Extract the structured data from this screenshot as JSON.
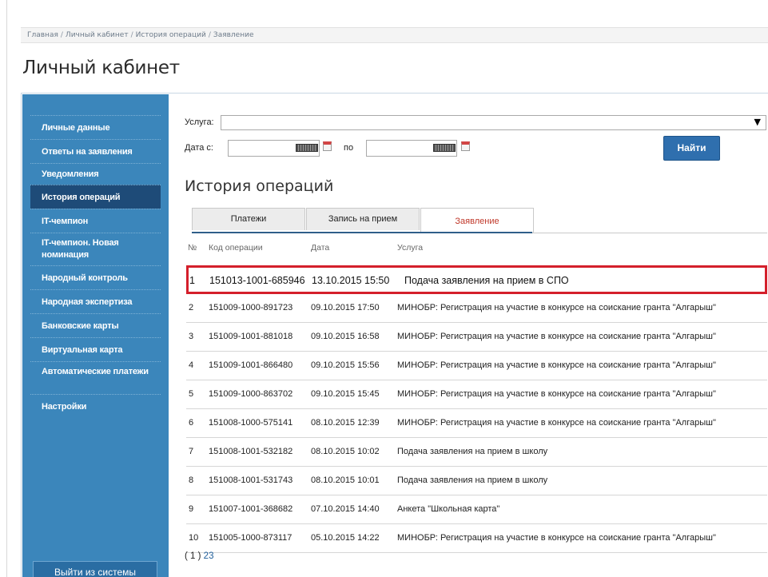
{
  "breadcrumb": [
    "Главная",
    "Личный кабинет",
    "История операций",
    "Заявление"
  ],
  "breadcrumb_sep": "/",
  "page_title": "Личный кабинет",
  "sidebar": {
    "items": [
      {
        "label": "Личные данные",
        "active": false
      },
      {
        "label": "Ответы на заявления",
        "active": false
      },
      {
        "label": "Уведомления",
        "active": false
      },
      {
        "label": "История операций",
        "active": true
      },
      {
        "label": "IT-чемпион",
        "active": false
      },
      {
        "label": "IT-чемпион. Новая номинация",
        "active": false
      },
      {
        "label": "Народный контроль",
        "active": false
      },
      {
        "label": "Народная экспертиза",
        "active": false
      },
      {
        "label": "Банковские карты",
        "active": false
      },
      {
        "label": "Виртуальная карта",
        "active": false
      },
      {
        "label": "Автоматические платежи",
        "active": false
      },
      {
        "label": "Настройки",
        "active": false
      }
    ],
    "logout_label": "Выйти из системы"
  },
  "filters": {
    "service_label": "Услуга:",
    "service_value": "",
    "date_from_label": "Дата с:",
    "date_to_label": "по",
    "date_from_value": "",
    "date_to_value": "",
    "find_label": "Найти"
  },
  "history": {
    "title": "История операций",
    "tabs": [
      "Платежи",
      "Запись на прием",
      "Заявление"
    ],
    "active_tab": 2,
    "columns": [
      "№",
      "Код операции",
      "Дата",
      "Услуга"
    ],
    "rows": [
      {
        "num": "1",
        "code": "151013-1001-685946",
        "date": "13.10.2015 15:50",
        "service": "Подача заявления на прием в СПО"
      },
      {
        "num": "2",
        "code": "151009-1000-891723",
        "date": "09.10.2015 17:50",
        "service": "МИНОБР: Регистрация на участие в конкурсе на соискание гранта \"Алгарыш\""
      },
      {
        "num": "3",
        "code": "151009-1001-881018",
        "date": "09.10.2015 16:58",
        "service": "МИНОБР: Регистрация на участие в конкурсе на соискание гранта \"Алгарыш\""
      },
      {
        "num": "4",
        "code": "151009-1001-866480",
        "date": "09.10.2015 15:56",
        "service": "МИНОБР: Регистрация на участие в конкурсе на соискание гранта \"Алгарыш\""
      },
      {
        "num": "5",
        "code": "151009-1000-863702",
        "date": "09.10.2015 15:45",
        "service": "МИНОБР: Регистрация на участие в конкурсе на соискание гранта \"Алгарыш\""
      },
      {
        "num": "6",
        "code": "151008-1000-575141",
        "date": "08.10.2015 12:39",
        "service": "МИНОБР: Регистрация на участие в конкурсе на соискание гранта \"Алгарыш\""
      },
      {
        "num": "7",
        "code": "151008-1001-532182",
        "date": "08.10.2015 10:02",
        "service": "Подача заявления на прием в школу"
      },
      {
        "num": "8",
        "code": "151008-1001-531743",
        "date": "08.10.2015 10:01",
        "service": "Подача заявления на прием в школу"
      },
      {
        "num": "9",
        "code": "151007-1001-368682",
        "date": "07.10.2015 14:40",
        "service": "Анкета \"Школьная карта\""
      },
      {
        "num": "10",
        "code": "151005-1000-873117",
        "date": "05.10.2015 14:22",
        "service": "МИНОБР: Регистрация на участие в конкурсе на соискание гранта \"Алгарыш\""
      }
    ],
    "highlighted_row": 0
  },
  "pager": {
    "current": "1",
    "pages": [
      "2",
      "3"
    ]
  },
  "colors": {
    "sidebar": "#3b86bb",
    "sidebar_active": "#1e4b78",
    "highlight": "#d41f2b",
    "button": "#2f6fae"
  }
}
